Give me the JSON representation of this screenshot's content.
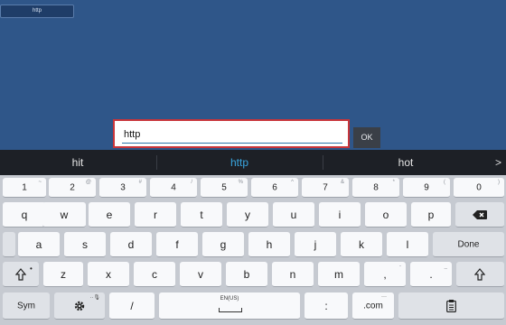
{
  "page": {
    "url_chip": "http"
  },
  "input": {
    "value": "http",
    "ok_label": "OK"
  },
  "suggestions": {
    "items": [
      "hit",
      "http",
      "hot"
    ],
    "active_index": 1,
    "more_symbol": ">"
  },
  "keyboard": {
    "row1": [
      {
        "main": "1",
        "sub": "~"
      },
      {
        "main": "2",
        "sub": "@"
      },
      {
        "main": "3",
        "sub": "#"
      },
      {
        "main": "4",
        "sub": "/"
      },
      {
        "main": "5",
        "sub": "%"
      },
      {
        "main": "6",
        "sub": "^"
      },
      {
        "main": "7",
        "sub": "&"
      },
      {
        "main": "8",
        "sub": "*"
      },
      {
        "main": "9",
        "sub": "("
      },
      {
        "main": "0",
        "sub": ")"
      }
    ],
    "row2": [
      "q",
      "w",
      "e",
      "r",
      "t",
      "y",
      "u",
      "i",
      "o",
      "p"
    ],
    "row3": [
      "a",
      "s",
      "d",
      "f",
      "g",
      "h",
      "j",
      "k",
      "l"
    ],
    "row4": [
      "z",
      "x",
      "c",
      "v",
      "b",
      "n",
      "m"
    ],
    "row4_extra": [
      {
        "main": ",",
        "sub": "-"
      },
      {
        "main": ".",
        "sub": "_"
      }
    ],
    "labels": {
      "done": "Done",
      "sym": "Sym",
      "slash": "/",
      "space_locale": "EN(US)",
      "colon": ":",
      "dotcom": ".com",
      "dotcom_sub": "···"
    },
    "icons": {
      "backspace": "backspace-icon",
      "shift": "shift-icon",
      "settings": "gear-icon",
      "clipboard": "clipboard-icon"
    }
  }
}
